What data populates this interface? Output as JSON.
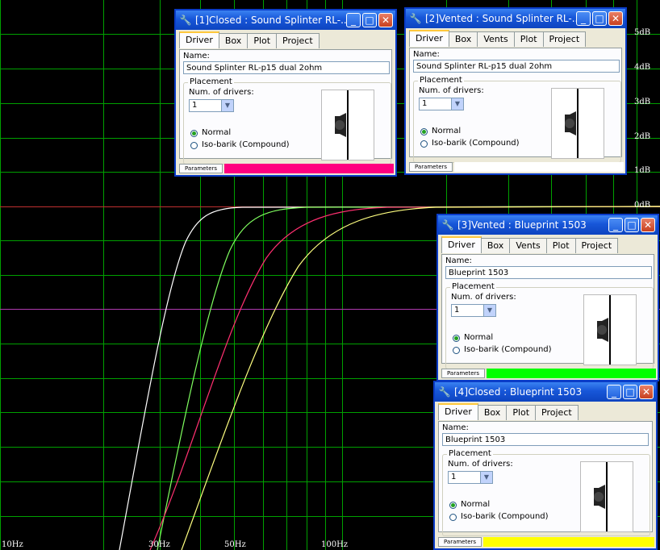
{
  "graph": {
    "db_labels": [
      "5dB",
      "4dB",
      "3dB",
      "2dB",
      "1dB",
      "0dB"
    ],
    "hz_labels": [
      "10Hz",
      "30Hz",
      "50Hz",
      "100Hz"
    ],
    "colors": {
      "grid": "#00a000",
      "zero_line": "#c03030",
      "marker_line": "#b03ab0",
      "curve1": "#ffffff",
      "curve2": "#ff3070",
      "curve3": "#80ff60",
      "curve4": "#ffff80"
    }
  },
  "windows": [
    {
      "title": "[1]Closed : Sound Splinter RL-...",
      "tabs": [
        "Driver",
        "Box",
        "Plot",
        "Project"
      ],
      "name_label": "Name:",
      "name_value": "Sound Splinter RL-p15 dual 2ohm",
      "placement_title": "Placement",
      "num_drivers_label": "Num. of drivers:",
      "num_drivers": "1",
      "radio_normal": "Normal",
      "radio_isobarik": "Iso-barik (Compound)",
      "status_tab": "Parameters",
      "color": "#ff0080"
    },
    {
      "title": "[2]Vented : Sound Splinter RL-...",
      "tabs": [
        "Driver",
        "Box",
        "Vents",
        "Plot",
        "Project"
      ],
      "name_label": "Name:",
      "name_value": "Sound Splinter RL-p15 dual 2ohm",
      "placement_title": "Placement",
      "num_drivers_label": "Num. of drivers:",
      "num_drivers": "1",
      "radio_normal": "Normal",
      "radio_isobarik": "Iso-barik (Compound)",
      "status_tab": "Parameters",
      "color": "#ffffff"
    },
    {
      "title": "[3]Vented : Blueprint 1503",
      "tabs": [
        "Driver",
        "Box",
        "Vents",
        "Plot",
        "Project"
      ],
      "name_label": "Name:",
      "name_value": "Blueprint 1503",
      "placement_title": "Placement",
      "num_drivers_label": "Num. of drivers:",
      "num_drivers": "1",
      "radio_normal": "Normal",
      "radio_isobarik": "Iso-barik (Compound)",
      "status_tab": "Parameters",
      "color": "#00ff00"
    },
    {
      "title": "[4]Closed : Blueprint 1503",
      "tabs": [
        "Driver",
        "Box",
        "Plot",
        "Project"
      ],
      "name_label": "Name:",
      "name_value": "Blueprint 1503",
      "placement_title": "Placement",
      "num_drivers_label": "Num. of drivers:",
      "num_drivers": "1",
      "radio_normal": "Normal",
      "radio_isobarik": "Iso-barik (Compound)",
      "status_tab": "Parameters",
      "color": "#ffff00"
    }
  ]
}
